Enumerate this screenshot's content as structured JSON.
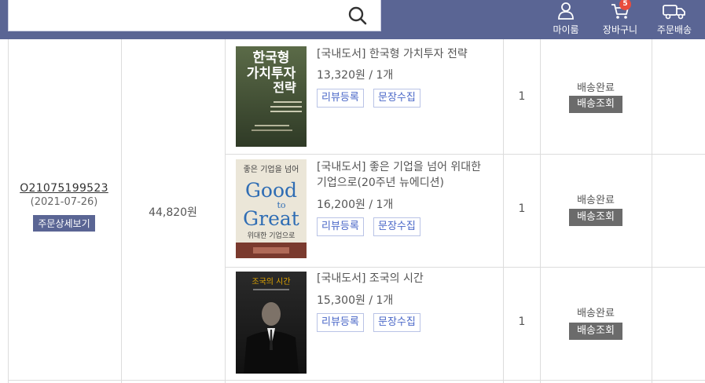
{
  "header": {
    "search": {
      "value": "",
      "placeholder": ""
    },
    "my_room": "마이룸",
    "cart": {
      "label": "장바구니",
      "badge": "5"
    },
    "order_delivery": "주문배송"
  },
  "order": {
    "number": "O21075199523",
    "date": "(2021-07-26)",
    "detail_button": "주문상세보기",
    "total": "44,820원"
  },
  "items": [
    {
      "title": "[국내도서] 한국형 가치투자 전략",
      "price_qty": "13,320원 / 1개",
      "review": "리뷰등록",
      "sentence": "문장수집",
      "qty": "1",
      "status": "배송완료",
      "track": "배송조회",
      "cover": {
        "line1": "한국형",
        "line2": "가치투자",
        "line3": "전략",
        "bg": "#4a5a3a"
      }
    },
    {
      "title": "[국내도서] 좋은 기업을 넘어 위대한 기업으로(20주년 뉴에디션)",
      "price_qty": "16,200원 / 1개",
      "review": "리뷰등록",
      "sentence": "문장수집",
      "qty": "1",
      "status": "배송완료",
      "track": "배송조회",
      "cover": {
        "top": "좋은 기업을 넘어",
        "big1": "Good",
        "mid": "to",
        "big2": "Great",
        "sub": "위대한 기업으로",
        "bg": "#e9e4d6"
      }
    },
    {
      "title": "[국내도서] 조국의 시간",
      "price_qty": "15,300원 / 1개",
      "review": "리뷰등록",
      "sentence": "문장수집",
      "qty": "1",
      "status": "배송완료",
      "track": "배송조회",
      "cover": {
        "title": "조국의 시간",
        "bg": "#1e1e1e"
      }
    }
  ]
}
